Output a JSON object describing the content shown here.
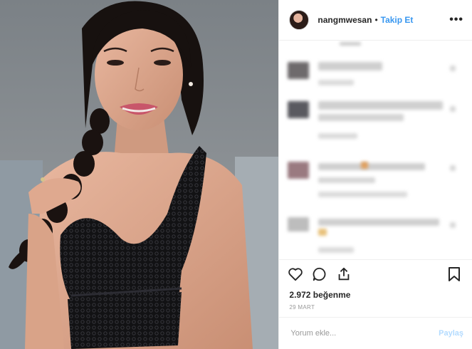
{
  "header": {
    "username": "nangmwesan",
    "separator": "•",
    "follow_label": "Takip Et",
    "more_label": "•••"
  },
  "actions": {
    "like_icon": "heart-icon",
    "comment_icon": "comment-icon",
    "share_icon": "share-icon",
    "save_icon": "bookmark-icon"
  },
  "likes_text": "2.972 beğenme",
  "date_text": "29 MART",
  "comment_box": {
    "placeholder": "Yorum ekle...",
    "submit_label": "Paylaş"
  },
  "colors": {
    "accent": "#3897f0",
    "text": "#262626",
    "muted": "#999999",
    "divider": "#efefef"
  }
}
